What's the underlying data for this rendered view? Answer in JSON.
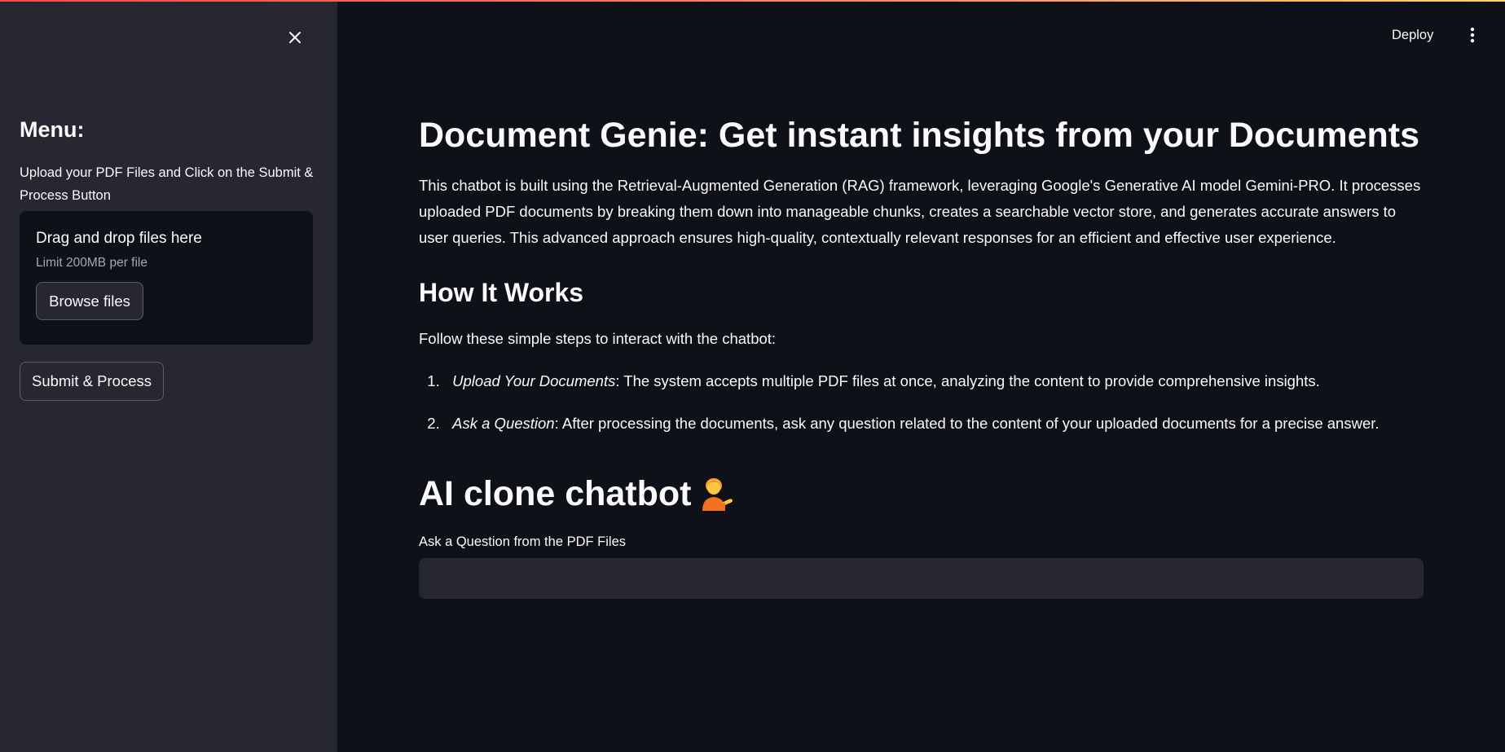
{
  "header": {
    "deploy_label": "Deploy",
    "more_icon": "vertical-ellipsis-icon"
  },
  "sidebar": {
    "close_icon": "close-icon",
    "menu_title": "Menu:",
    "description": "Upload your PDF Files and Click on the Submit & Process Button",
    "dropzone": {
      "title": "Drag and drop files here",
      "limit": "Limit 200MB per file",
      "browse_label": "Browse files"
    },
    "submit_label": "Submit & Process"
  },
  "main": {
    "title": "Document Genie: Get instant insights from your Documents",
    "intro": "This chatbot is built using the Retrieval-Augmented Generation (RAG) framework, leveraging Google's Generative AI model Gemini-PRO. It processes uploaded PDF documents by breaking them down into manageable chunks, creates a searchable vector store, and generates accurate answers to user queries. This advanced approach ensures high-quality, contextually relevant responses for an efficient and effective user experience.",
    "how_title": "How It Works",
    "steps_intro": "Follow these simple steps to interact with the chatbot:",
    "steps": [
      {
        "number": "1.",
        "title": "Upload Your Documents",
        "text": ": The system accepts multiple PDF files at once, analyzing the content to provide comprehensive insights."
      },
      {
        "number": "2.",
        "title": "Ask a Question",
        "text": ": After processing the documents, ask any question related to the content of your uploaded documents for a precise answer."
      }
    ],
    "chat_title": "AI clone chatbot",
    "chat_icon": "person-tipping-hand-icon",
    "question_label": "Ask a Question from the PDF Files",
    "question_value": ""
  },
  "colors": {
    "background": "#0e1117",
    "sidebar": "#262730",
    "input": "#262730",
    "text": "#fafafa",
    "muted": "#a3a8b8",
    "accent": "#ff4b4b"
  }
}
